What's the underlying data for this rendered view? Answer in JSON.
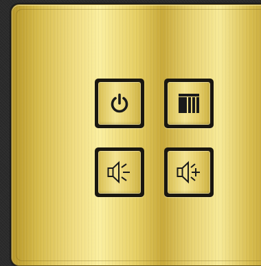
{
  "panel": {
    "finish": "brushed-gold",
    "colors": {
      "gold_light": "#fbef9f",
      "gold_mid": "#e6cf63",
      "gold_dark": "#b8982a",
      "frame": "#1a1710",
      "background": "#2a2a2a",
      "icon": "#1a1a1a"
    },
    "buttons": [
      {
        "id": "power",
        "icon": "power-icon"
      },
      {
        "id": "input",
        "icon": "input-source-icon"
      },
      {
        "id": "volume_down",
        "icon": "volume-down-icon"
      },
      {
        "id": "volume_up",
        "icon": "volume-up-icon"
      }
    ]
  }
}
